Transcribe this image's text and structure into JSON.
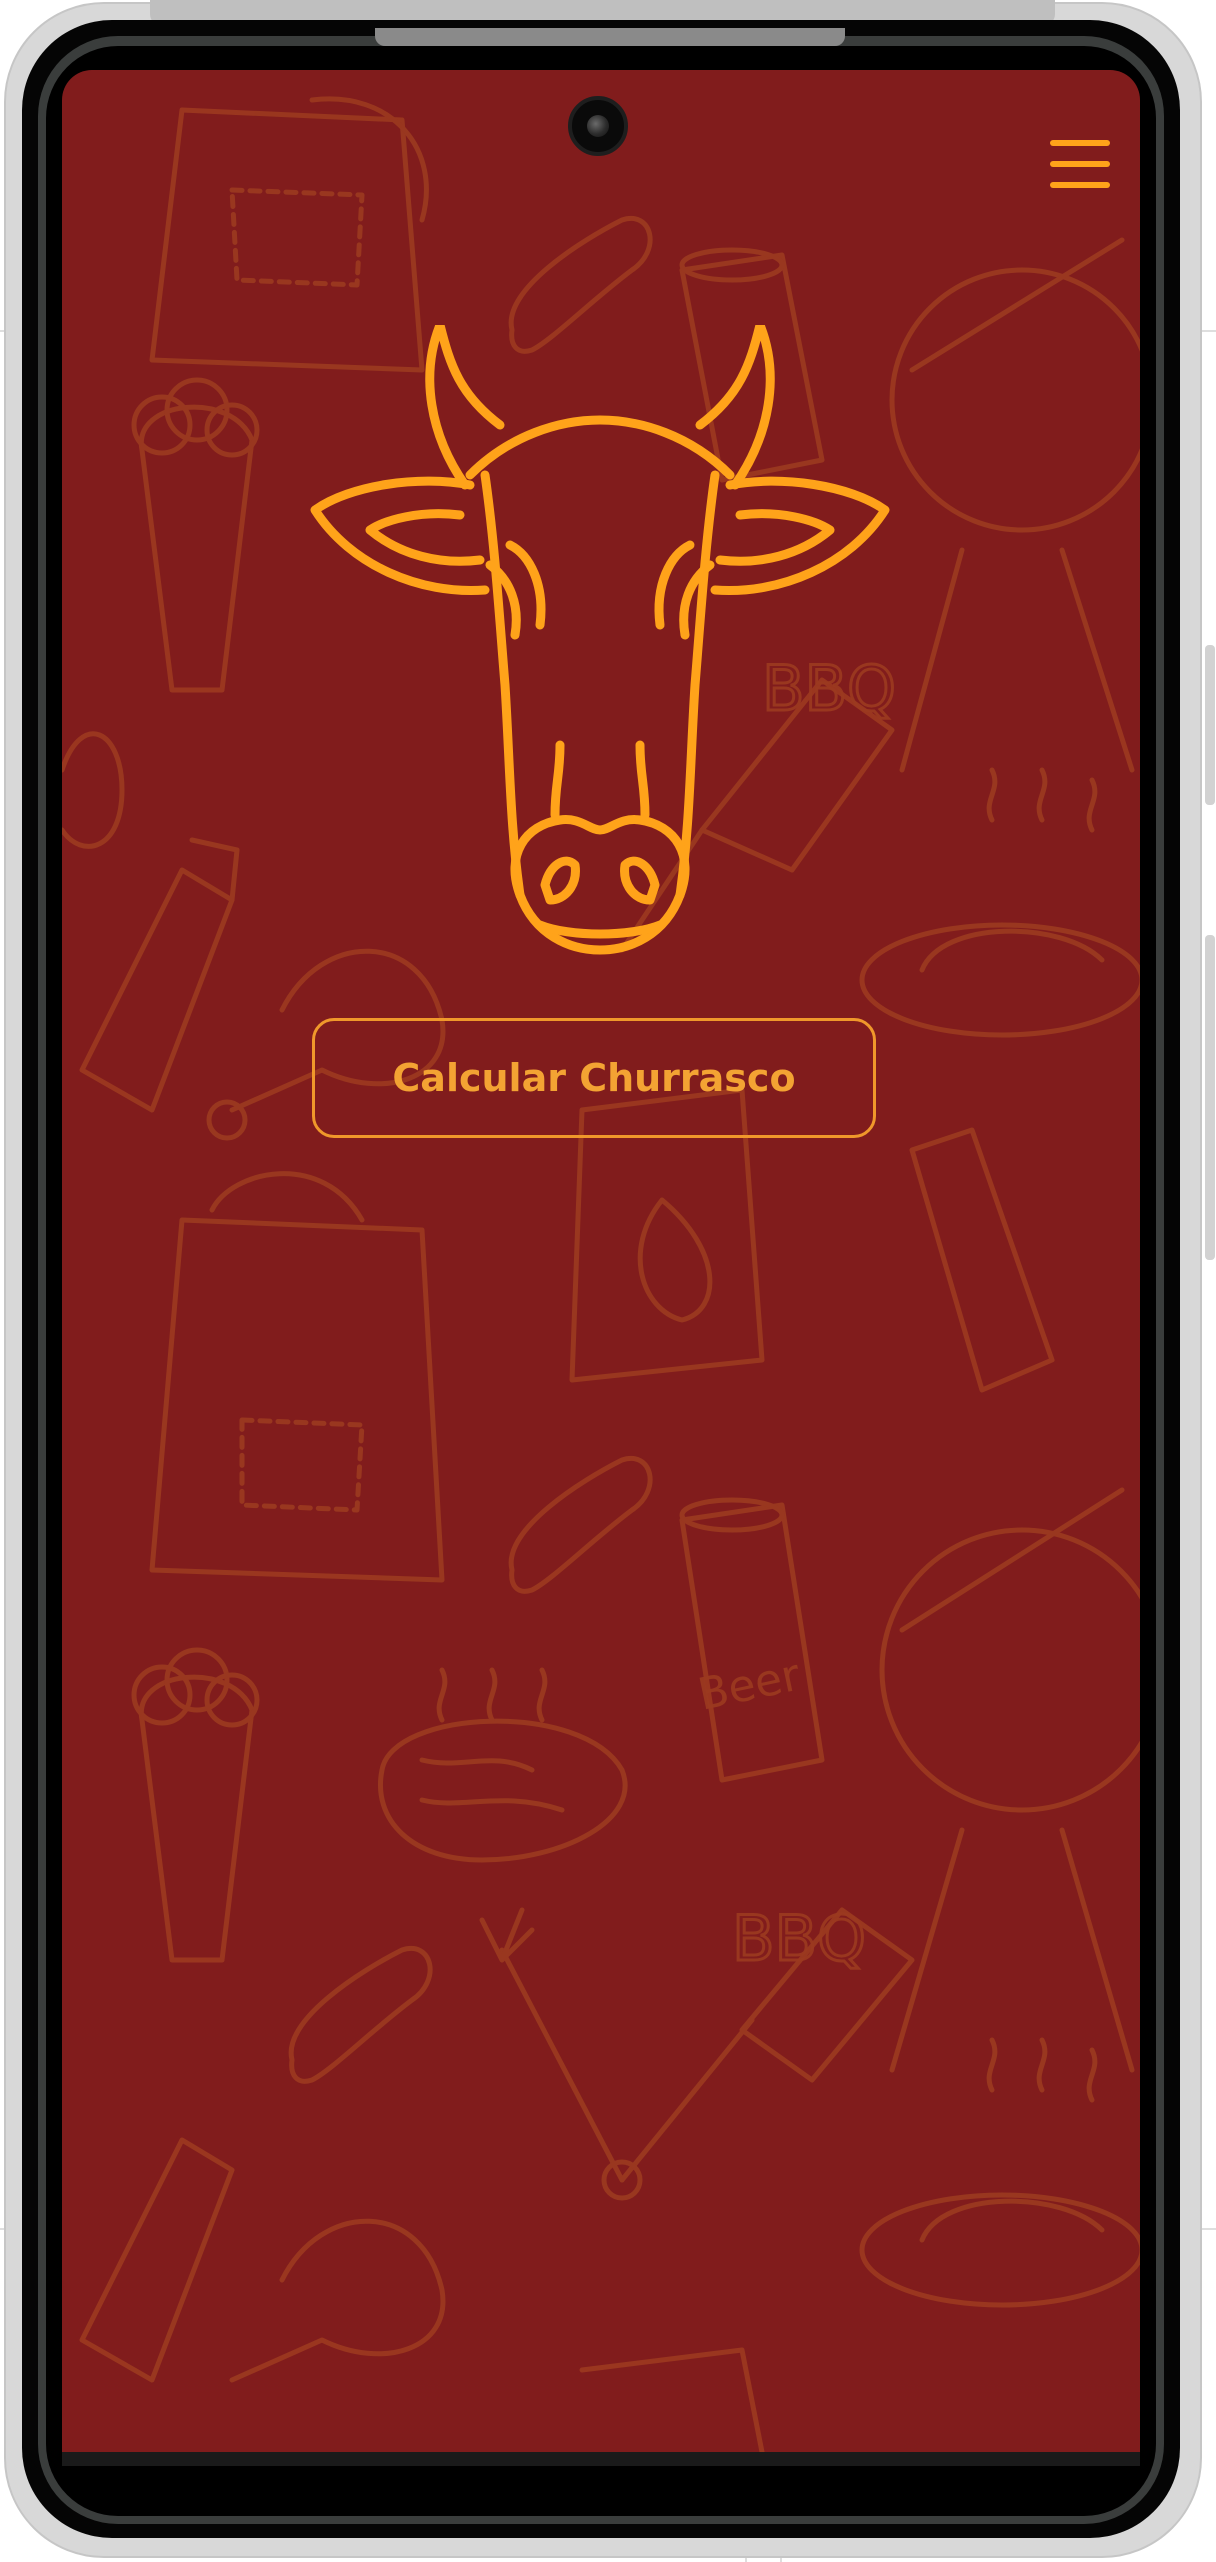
{
  "app": {
    "calculate_button_label": "Calcular Churrasco",
    "pattern_words": {
      "beer": "Beer",
      "bbq": "BBQ"
    }
  },
  "icons": {
    "menu": "hamburger-menu-icon",
    "logo": "bull-head-icon",
    "camera": "front-camera"
  },
  "colors": {
    "background": "#811c1c",
    "accent": "#ffa31a",
    "pattern": "#9c3a20"
  }
}
